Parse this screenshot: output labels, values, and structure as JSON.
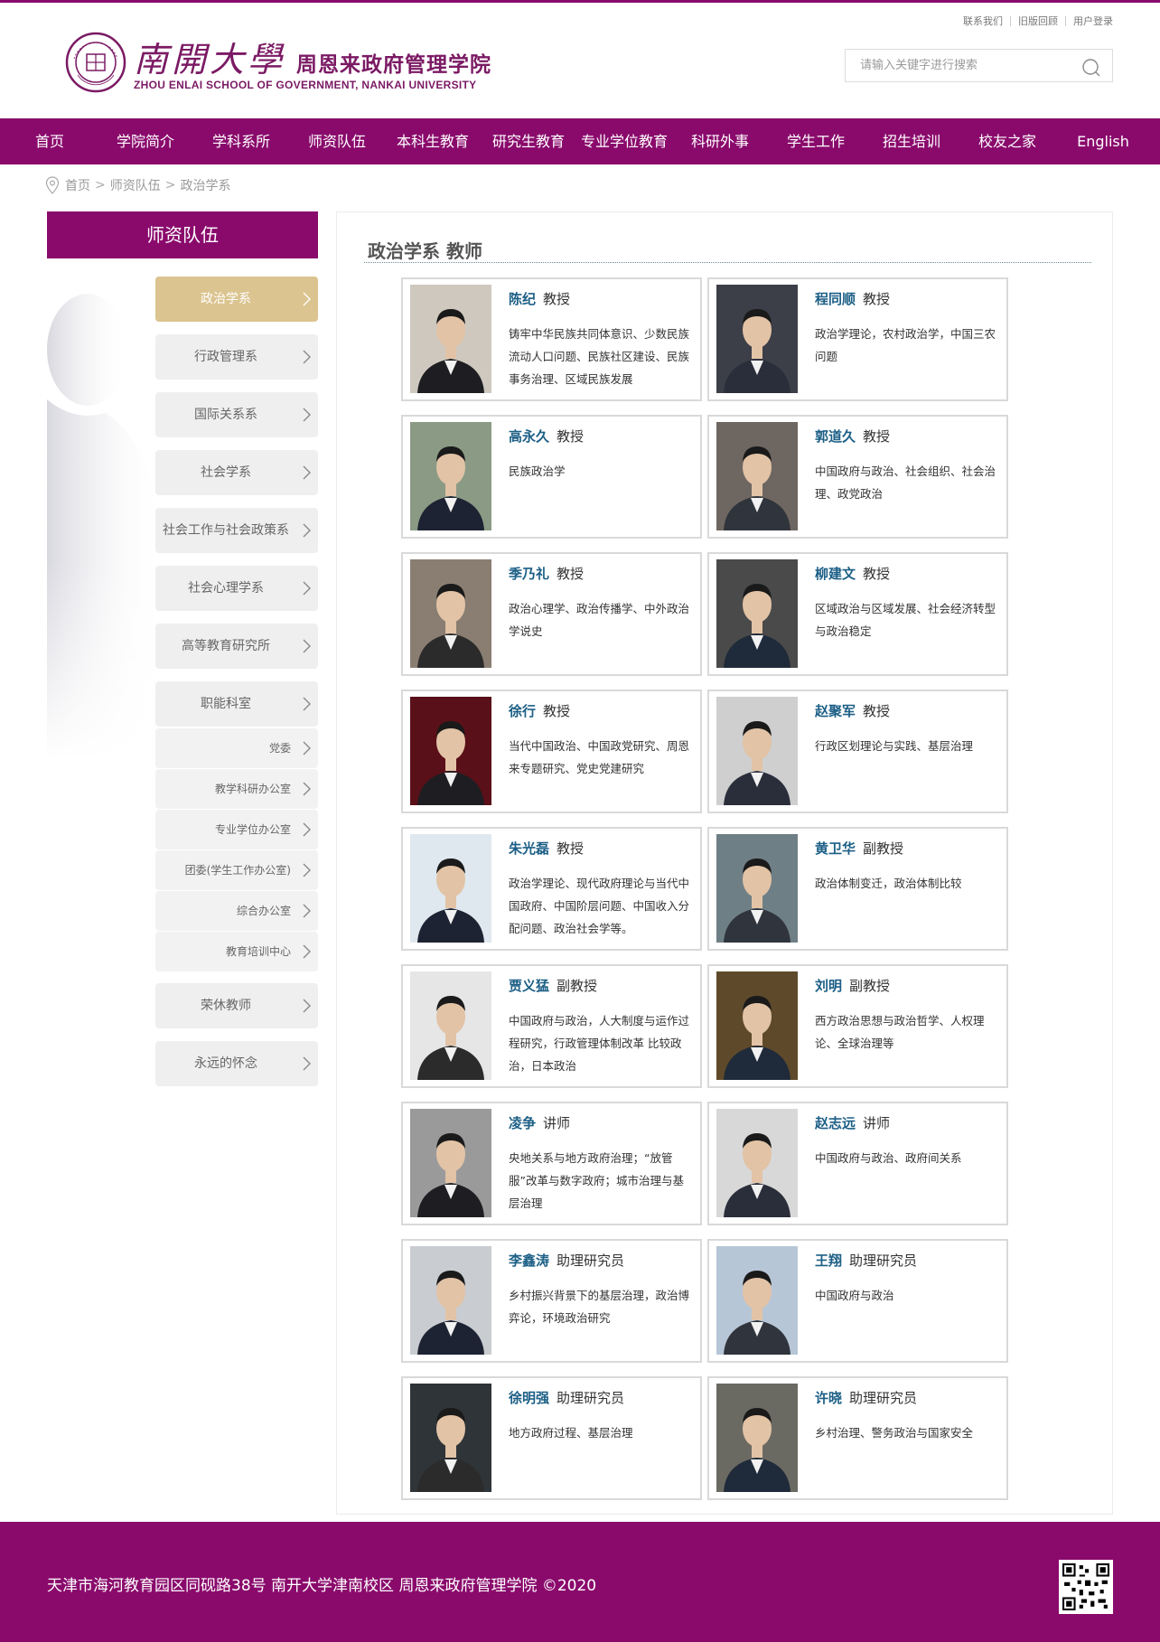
{
  "header": {
    "logo_cn_big": "南開大學",
    "logo_cn_small": "周恩来政府管理学院",
    "logo_en": "ZHOU ENLAI SCHOOL OF  GOVERNMENT, NANKAI UNIVERSITY",
    "seal_text": "NANKAI UNIVERSITY",
    "seal_year": "1919",
    "links": [
      "联系我们",
      "旧版回顾",
      "用户登录"
    ],
    "search_placeholder": "请输入关键字进行搜索"
  },
  "nav": [
    "首页",
    "学院简介",
    "学科系所",
    "师资队伍",
    "本科生教育",
    "研究生教育",
    "专业学位教育",
    "科研外事",
    "学生工作",
    "招生培训",
    "校友之家",
    "English"
  ],
  "breadcrumb": [
    "首页",
    "师资队伍",
    "政治学系"
  ],
  "sidebar": {
    "title": "师资队伍",
    "items": [
      {
        "label": "政治学系",
        "active": true
      },
      {
        "label": "行政管理系"
      },
      {
        "label": "国际关系系"
      },
      {
        "label": "社会学系"
      },
      {
        "label": "社会工作与社会政策系"
      },
      {
        "label": "社会心理学系"
      },
      {
        "label": "高等教育研究所"
      },
      {
        "label": "职能科室"
      },
      {
        "label": "党委",
        "sub": true
      },
      {
        "label": "教学科研办公室",
        "sub": true
      },
      {
        "label": "专业学位办公室",
        "sub": true
      },
      {
        "label": "团委(学生工作办公室)",
        "sub": true
      },
      {
        "label": "综合办公室",
        "sub": true
      },
      {
        "label": "教育培训中心",
        "sub": true
      },
      {
        "label": "荣休教师"
      },
      {
        "label": "永远的怀念"
      }
    ]
  },
  "content": {
    "title": "政治学系 教师",
    "people": [
      {
        "name": "陈纪",
        "title": "教授",
        "desc": "铸牢中华民族共同体意识、少数民族流动人口问题、民族社区建设、民族事务治理、区域民族发展"
      },
      {
        "name": "程同顺",
        "title": "教授",
        "desc": "政治学理论，农村政治学，中国三农问题"
      },
      {
        "name": "高永久",
        "title": "教授",
        "desc": "民族政治学"
      },
      {
        "name": "郭道久",
        "title": "教授",
        "desc": "中国政府与政治、社会组织、社会治理、政党政治"
      },
      {
        "name": "季乃礼",
        "title": "教授",
        "desc": "政治心理学、政治传播学、中外政治学说史"
      },
      {
        "name": "柳建文",
        "title": "教授",
        "desc": "区域政治与区域发展、社会经济转型与政治稳定"
      },
      {
        "name": "徐行",
        "title": "教授",
        "desc": "当代中国政治、中国政党研究、周恩来专题研究、党史党建研究"
      },
      {
        "name": "赵聚军",
        "title": "教授",
        "desc": "行政区划理论与实践、基层治理"
      },
      {
        "name": "朱光磊",
        "title": "教授",
        "desc": "政治学理论、现代政府理论与当代中国政府、中国阶层问题、中国收入分配问题、政治社会学等。"
      },
      {
        "name": "黄卫华",
        "title": "副教授",
        "desc": "政治体制变迁，政治体制比较"
      },
      {
        "name": "贾义猛",
        "title": "副教授",
        "desc": "中国政府与政治，人大制度与运作过程研究，行政管理体制改革 比较政治，日本政治"
      },
      {
        "name": "刘明",
        "title": "副教授",
        "desc": "西方政治思想与政治哲学、人权理论、全球治理等"
      },
      {
        "name": "凌争",
        "title": "讲师",
        "desc": "央地关系与地方政府治理；“放管服”改革与数字政府；城市治理与基层治理"
      },
      {
        "name": "赵志远",
        "title": "讲师",
        "desc": "中国政府与政治、政府间关系"
      },
      {
        "name": "李鑫涛",
        "title": "助理研究员",
        "desc": "乡村振兴背景下的基层治理，政治博弈论，环境政治研究"
      },
      {
        "name": "王翔",
        "title": "助理研究员",
        "desc": "中国政府与政治"
      },
      {
        "name": "徐明强",
        "title": "助理研究员",
        "desc": "地方政府过程、基层治理"
      },
      {
        "name": "许晓",
        "title": "助理研究员",
        "desc": "乡村治理、警务政治与国家安全"
      }
    ]
  },
  "footer": {
    "address": "天津市海河教育园区同砚路38号  南开大学津南校区    周恩来政府管理学院 ©2020"
  },
  "colors": {
    "brand": "#8a0a6c",
    "active": "#dbc48f",
    "name": "#1c5f86"
  }
}
